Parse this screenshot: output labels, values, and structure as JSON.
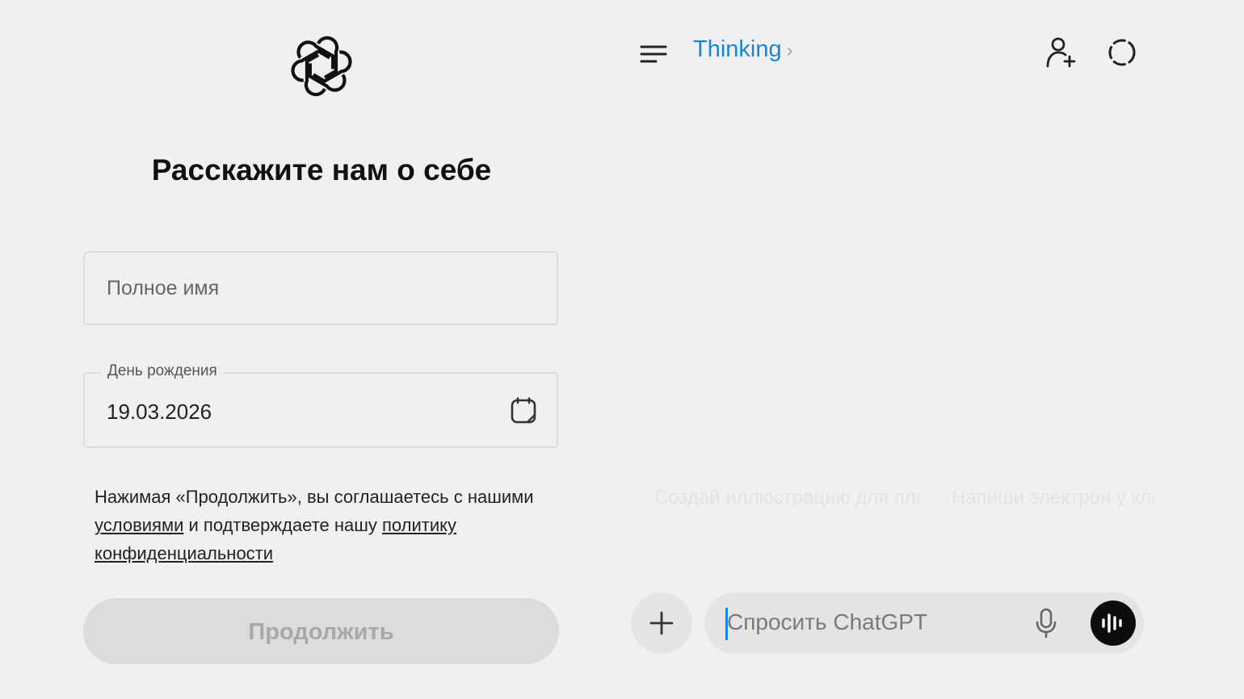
{
  "signup": {
    "title": "Расскажите нам о себе",
    "name_placeholder": "Полное имя",
    "birthday_label": "День рождения",
    "birthday_value": "19.03.2026",
    "consent_part1": "Нажимая «Продолжить», вы соглашаетесь с нашими ",
    "terms_link": "условиями",
    "consent_part2": " и подтверждаете нашу ",
    "privacy_link": "политику конфиденциальности",
    "continue_label": "Продолжить"
  },
  "chat": {
    "model_label": "Thinking",
    "model_chevron": "›",
    "suggestions": [
      "Создай иллюстрацию для плакате",
      "Напиши электрон у клиентов отзыв"
    ],
    "input_placeholder": "Спросить ChatGPT",
    "plus_label": "+"
  },
  "icons": {
    "logo": "openai-logo",
    "menu": "menu-icon",
    "add_user": "add-user-icon",
    "temporary_chat": "temporary-chat-icon",
    "calendar": "calendar-icon",
    "mic": "mic-icon",
    "voice": "voice-mode-icon"
  },
  "colors": {
    "background": "#f0f0f0",
    "accent": "#1a86d6",
    "button_disabled": "#dcdcdc",
    "voice_button": "#0d0d0d"
  }
}
